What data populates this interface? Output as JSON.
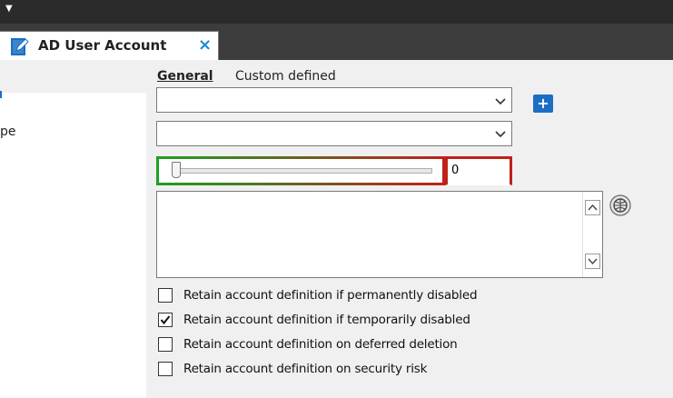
{
  "tab": {
    "title": "AD User Account",
    "close_glyph": "×",
    "icon": "edit-document-icon"
  },
  "subtabs": [
    {
      "label": "General",
      "active": true
    },
    {
      "label": "Custom defined",
      "active": false
    }
  ],
  "left_panel": {
    "fragment_text": "pe"
  },
  "form": {
    "combo1": {
      "value": ""
    },
    "combo2": {
      "value": ""
    },
    "add_button_glyph": "+",
    "slider": {
      "value": 0,
      "gradient_from": "#1aa025",
      "gradient_to": "#c0201a"
    },
    "number_value": "0",
    "textarea_value": ""
  },
  "checkboxes": [
    {
      "label": "Retain account definition if permanently disabled",
      "checked": false
    },
    {
      "label": "Retain account definition if temporarily disabled",
      "checked": true
    },
    {
      "label": "Retain account definition on deferred deletion",
      "checked": false
    },
    {
      "label": "Retain account definition on security risk",
      "checked": false
    }
  ],
  "colors": {
    "accent": "#1a6fc4",
    "close": "#1a8ad4",
    "titlebar": "#2b2b2b",
    "tabstrip": "#3c3c3c"
  }
}
